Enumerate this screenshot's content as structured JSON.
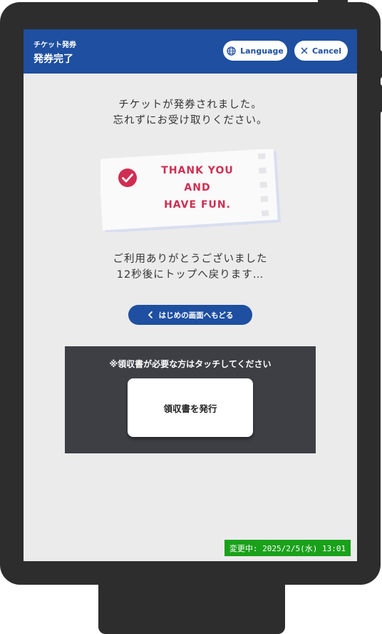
{
  "header": {
    "subtitle": "チケット発券",
    "title": "発券完了",
    "language_label": "Language",
    "language_icon": "globe-icon",
    "cancel_label": "Cancel",
    "cancel_icon": "close-icon",
    "color": "#1e4fa0"
  },
  "main": {
    "message_line1": "チケットが発券されました。",
    "message_line2": "忘れずにお受け取りください。",
    "ticket": {
      "check_icon": "check-circle-icon",
      "line1": "THANK YOU",
      "line2": "AND",
      "line3": "HAVE FUN.",
      "accent_color": "#cf2e52"
    },
    "thanks_line1": "ご利用ありがとうございました",
    "thanks_line2": "12秒後にトップへ戻ります…",
    "back_button_label": "はじめの画面へもどる",
    "back_icon": "chevron-left-icon"
  },
  "receipt": {
    "note": "※領収書が必要な方はタッチしてください",
    "button_label": "領収書を発行"
  },
  "status": {
    "text": "変更中: 2025/2/5(水) 13:01",
    "color": "#1aa11a"
  }
}
